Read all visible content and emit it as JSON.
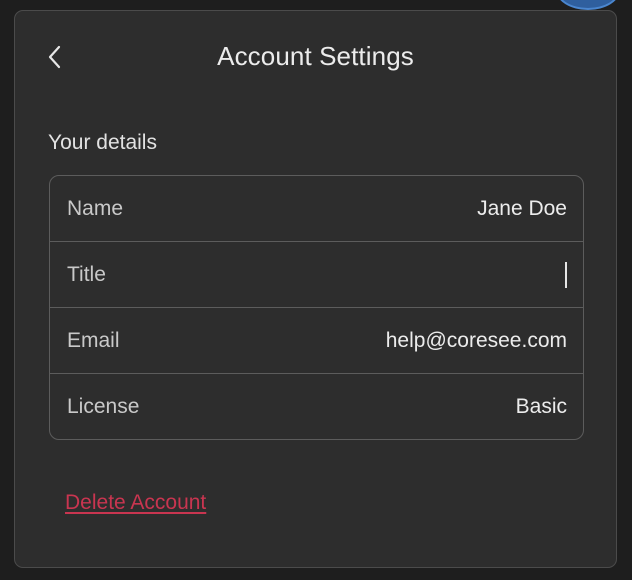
{
  "header": {
    "back_icon": "chevron-left-icon",
    "title": "Account Settings"
  },
  "details": {
    "section_label": "Your details",
    "rows": [
      {
        "label": "Name",
        "value": "Jane Doe"
      },
      {
        "label": "Title",
        "value": ""
      },
      {
        "label": "Email",
        "value": "help@coresee.com"
      },
      {
        "label": "License",
        "value": "Basic"
      }
    ]
  },
  "actions": {
    "delete_label": "Delete Account"
  },
  "colors": {
    "panel_bg": "#2d2d2d",
    "border": "#5c5c5c",
    "text": "#ececec",
    "danger": "#c93550"
  }
}
